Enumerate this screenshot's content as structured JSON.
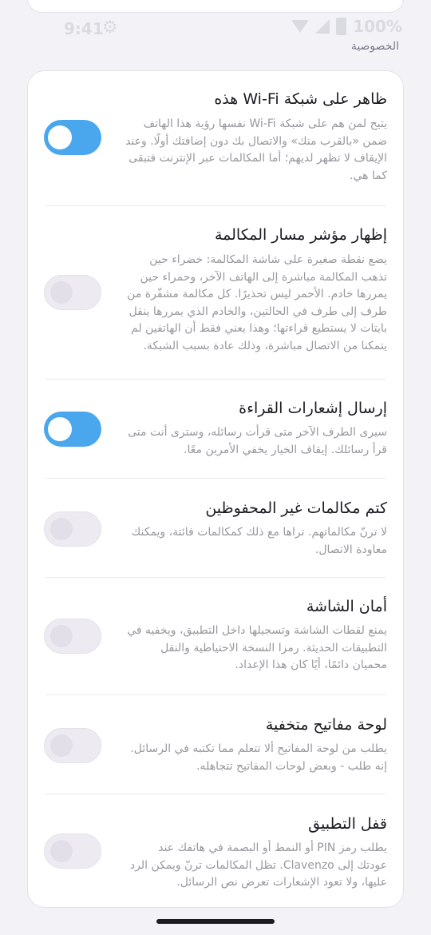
{
  "status_bar": {
    "time": "9:41",
    "battery": "100%",
    "settings_icon": "gear-icon",
    "wifi_icon": "wifi-icon",
    "signal_icon": "signal-icon",
    "battery_icon": "battery-icon"
  },
  "section": {
    "label": "الخصوصية"
  },
  "colors": {
    "toggle_on": "#4aa7ee",
    "toggle_off": "#edebf1"
  },
  "settings": [
    {
      "title": "ظاهر على شبكة Wi-Fi هذه",
      "description": "يتيح لمن هم على شبكة Wi-Fi نفسها رؤية هذا الهاتف ضمن «بالقرب منك» والاتصال بك دون إضافتك أولًا. وعند الإيقاف لا تظهر لديهم؛ أما المكالمات عبر الإنترنت فتبقى كما هي.",
      "enabled": true,
      "state": "on"
    },
    {
      "title": "إظهار مؤشر مسار المكالمة",
      "description": "يضع نقطة صغيرة على شاشة المكالمة: خضراء حين تذهب المكالمة مباشرة إلى الهاتف الآخر، وحمراء حين يمررها خادم. الأحمر ليس تحذيرًا. كل مكالمة مشفّرة من طرف إلى طرف في الحالتين، والخادم الذي يمررها ينقل بايتات لا يستطيع قراءتها؛ وهذا يعني فقط أن الهاتفين لم يتمكنا من الاتصال مباشرة، وذلك عادة بسبب الشبكة.",
      "enabled": false,
      "state": "off"
    },
    {
      "title": "إرسال إشعارات القراءة",
      "description": "سيرى الطرف الآخر متى قرأت رسائله، وسترى أنت متى قرأ رسائلك. إيقاف الخيار يخفي الأمرين معًا.",
      "enabled": true,
      "state": "on"
    },
    {
      "title": "كتم مكالمات غير المحفوظين",
      "description": "لا ترنّ مكالماتهم. تراها مع ذلك كمكالمات فائتة، ويمكنك معاودة الاتصال.",
      "enabled": false,
      "state": "off"
    },
    {
      "title": "أمان الشاشة",
      "description": "يمنع لقطات الشاشة وتسجيلها داخل التطبيق، ويخفيه في التطبيقات الحديثة. رمزا النسخة الاحتياطية والنقل محميان دائمًا، أيًا كان هذا الإعداد.",
      "enabled": false,
      "state": "off"
    },
    {
      "title": "لوحة مفاتيح متخفية",
      "description": "يطلب من لوحة المفاتيح ألا تتعلم مما تكتبه في الرسائل. إنه طلب - وبعض لوحات المفاتيح تتجاهله.",
      "enabled": false,
      "state": "off"
    },
    {
      "title": "قفل التطبيق",
      "description": "يطلب رمز PIN أو النمط أو البصمة في هاتفك عند عودتك إلى Clavenzo. تظل المكالمات ترنّ ويمكن الرد عليها، ولا تعود الإشعارات تعرض نص الرسائل.",
      "enabled": false,
      "state": "off"
    }
  ]
}
